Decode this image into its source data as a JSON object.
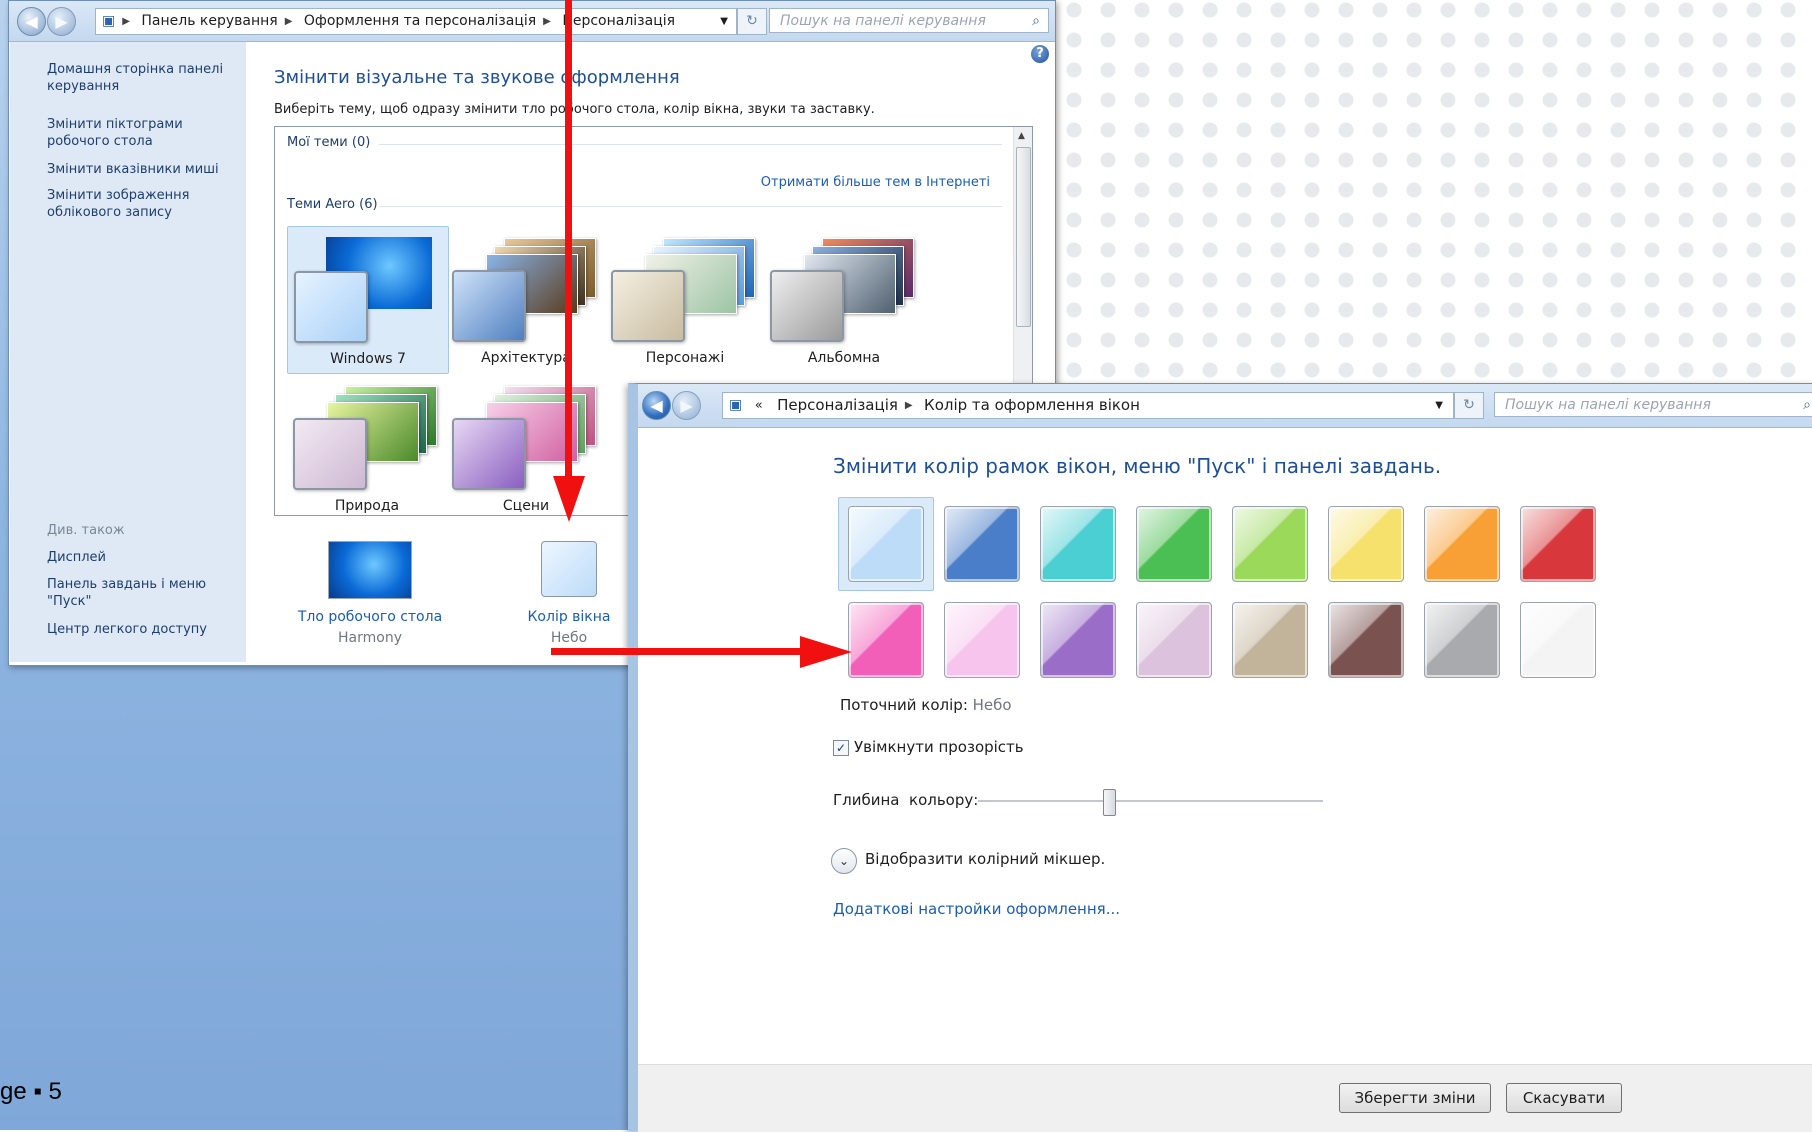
{
  "page_number": "ge ▪ 5",
  "window1": {
    "breadcrumbs": [
      "Панель керування",
      "Оформлення та персоналізація",
      "Персоналізація"
    ],
    "search_placeholder": "Пошук на панелі керування",
    "sidebar": {
      "links": [
        "Домашня сторінка панелі керування",
        "Змінити піктограми робочого стола",
        "Змінити вказівники миші",
        "Змінити зображення облікового запису"
      ],
      "see_also_heading": "Див. також",
      "see_also": [
        "Дисплей",
        "Панель завдань і меню \"Пуск\"",
        "Центр легкого доступу"
      ]
    },
    "title": "Змінити візуальне та звукове оформлення",
    "description": "Виберіть тему, щоб одразу змінити тло робочого стола, колір вікна, звуки та заставку.",
    "my_themes": "Мої теми (0)",
    "get_more": "Отримати більше тем в Інтернеті",
    "aero_themes": "Теми Aero (6)",
    "themes": [
      "Windows 7",
      "Архітектура",
      "Персонажі",
      "Альбомна",
      "Природа",
      "Сцени"
    ],
    "bottom": {
      "background": {
        "label": "Тло робочого стола",
        "value": "Harmony"
      },
      "window_color": {
        "label": "Колір вікна",
        "value": "Небо"
      }
    }
  },
  "window2": {
    "breadcrumbs": [
      "Персоналізація",
      "Колір та оформлення вікон"
    ],
    "search_placeholder": "Пошук на панелі керування",
    "title": "Змінити колір рамок вікон, меню \"Пуск\" і панелі завдань.",
    "swatch_colors": [
      "#bcdcf8",
      "#4a7ec8",
      "#4ccfd3",
      "#4bbf53",
      "#9bd95a",
      "#f6e16d",
      "#f8a035",
      "#d8383b",
      "#f25fb9",
      "#f6c4ec",
      "#9a6ec8",
      "#dcc2dc",
      "#c2b49a",
      "#7a5350",
      "#a8aaad",
      "#f4f4f4"
    ],
    "current_color_label": "Поточний колір:",
    "current_color_value": "Небо",
    "transparency": "Увімкнути прозорість",
    "transparency_checked": true,
    "intensity_label": "Глибина  кольору:",
    "intensity_fraction": 0.38,
    "mixer": "Відобразити колірний мікшер.",
    "advanced": "Додаткові настройки оформлення...",
    "save": "Зберегти зміни",
    "cancel": "Скасувати"
  }
}
